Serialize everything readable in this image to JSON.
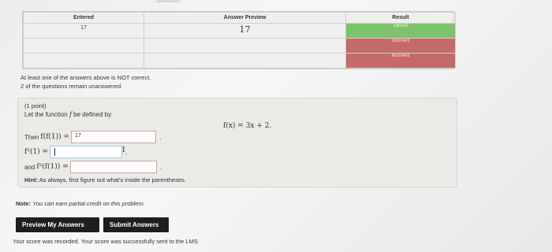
{
  "top_sliver": "... submission",
  "results": {
    "headers": {
      "entered": "Entered",
      "preview": "Answer Preview",
      "result": "Result"
    },
    "rows": [
      {
        "entered": "17",
        "preview": "17",
        "result": "correct",
        "color": "#7cc36a"
      },
      {
        "entered": "",
        "preview": "",
        "result": "incorrect",
        "color": "#c46a68"
      },
      {
        "entered": "",
        "preview": "",
        "result": "incorrect",
        "color": "#c46a68"
      }
    ]
  },
  "warning": {
    "line1": "At least one of the answers above is NOT correct.",
    "line2": "2 of the questions remain unanswered."
  },
  "problem": {
    "credit": "(1 point)",
    "intro_prefix": "Let the function",
    "intro_f": "f",
    "intro_suffix": "be defined by",
    "formula": "f(x) = 3x + 2.",
    "q1_prefix": "Then",
    "q1_math": "f(f(1)) =",
    "q1_value": "17",
    "q2_math": "f²(1) =",
    "q2_value": "",
    "q3_prefix": "and",
    "q3_math": "f²(f(1)) =",
    "q3_value": "",
    "hint_label": "Hint:",
    "hint_text": "As always, first figure out what's inside the parentheses."
  },
  "note": {
    "label": "Note:",
    "text": "You can earn partial credit on this problem."
  },
  "buttons": {
    "preview": "Preview My Answers",
    "submit": "Submit Answers"
  },
  "status": "Your score was recorded. Your score was successfully sent to the LMS"
}
